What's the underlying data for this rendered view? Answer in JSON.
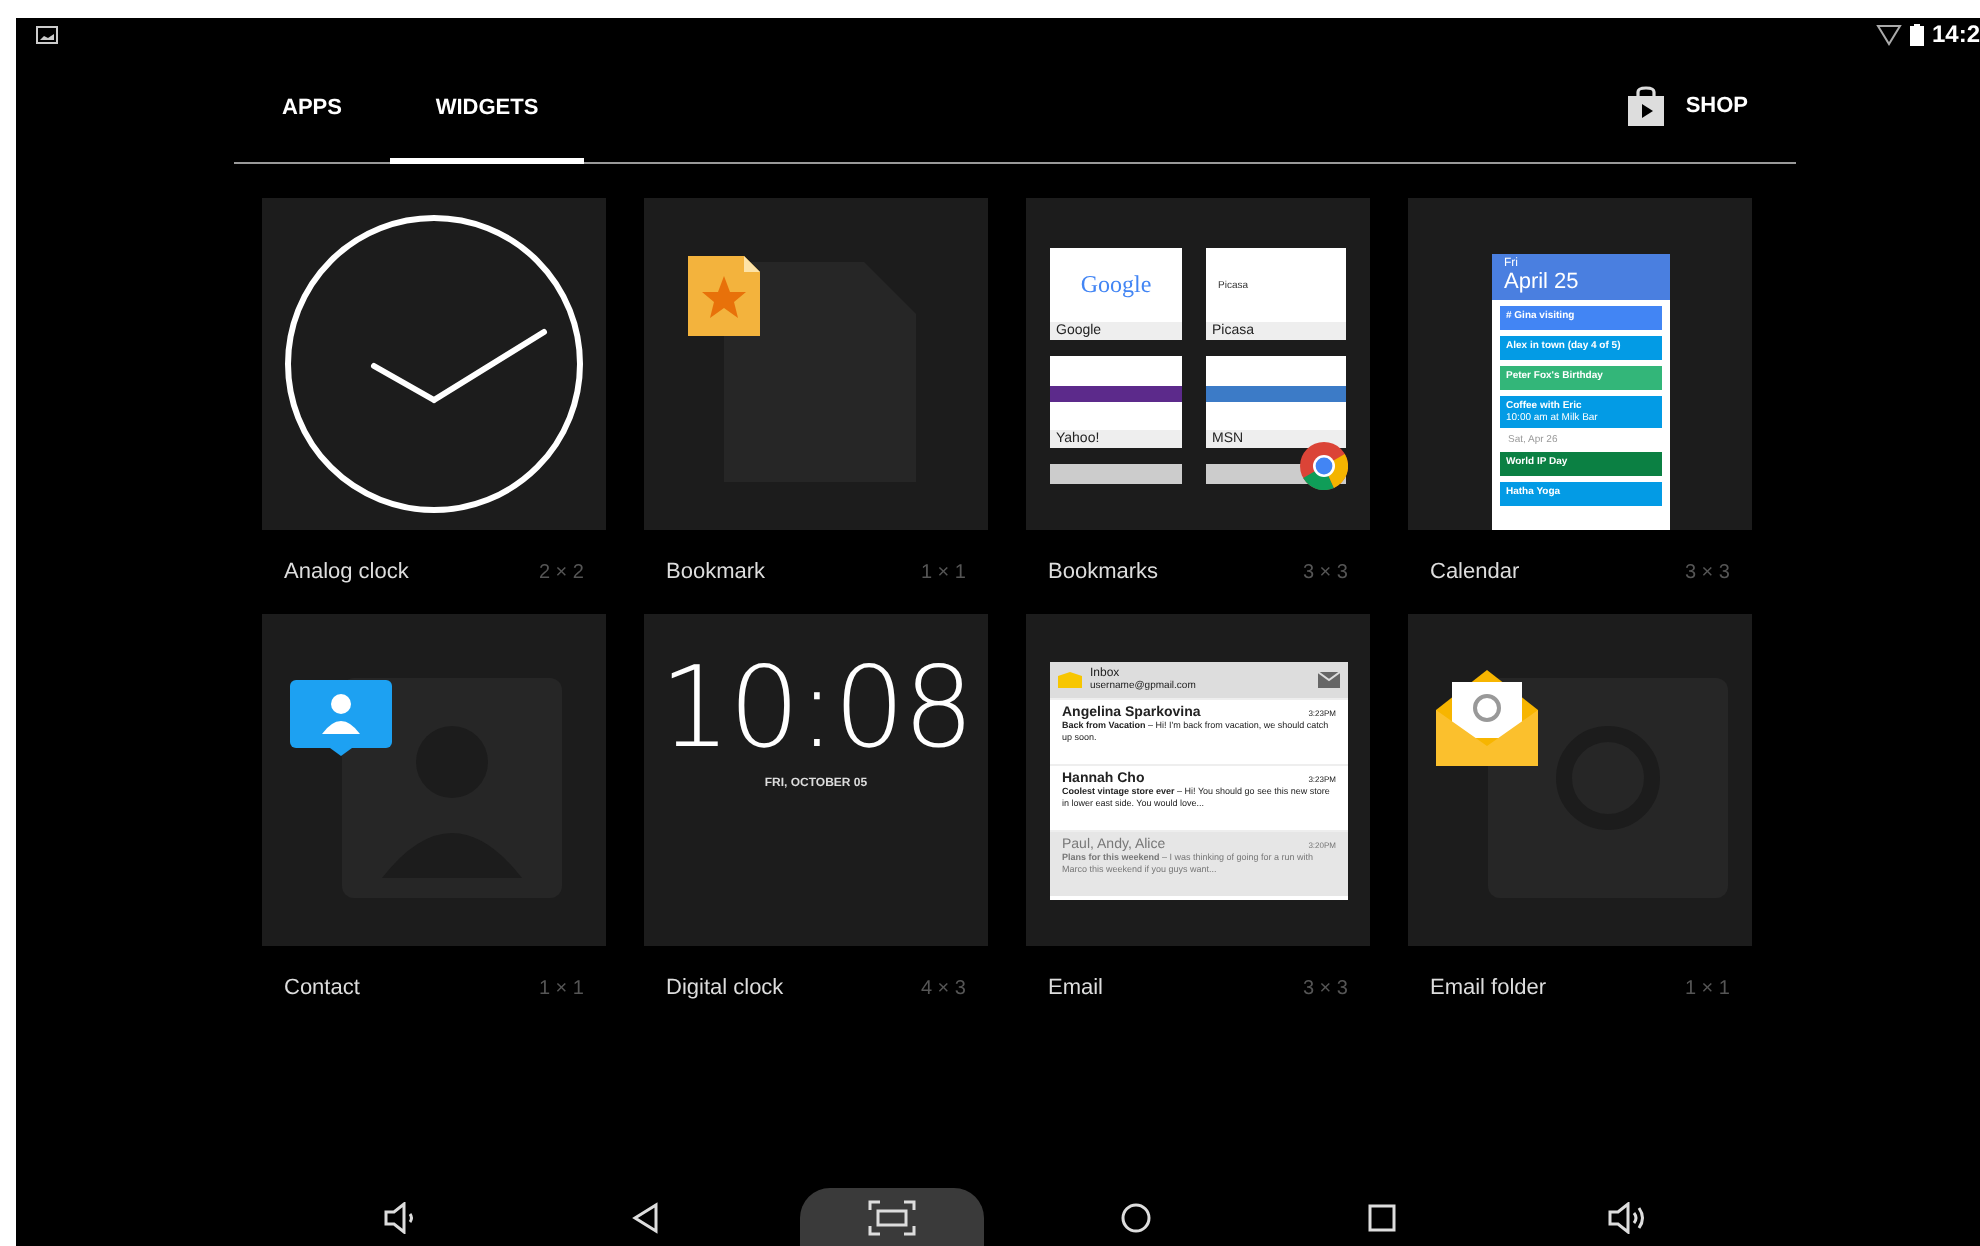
{
  "status_bar": {
    "time": "14:2"
  },
  "tabs": [
    {
      "label": "APPS",
      "selected": false
    },
    {
      "label": "WIDGETS",
      "selected": true
    }
  ],
  "shop": {
    "label": "SHOP"
  },
  "widgets": [
    {
      "name": "Analog clock",
      "size": "2 × 2",
      "kind": "analog_clock"
    },
    {
      "name": "Bookmark",
      "size": "1 × 1",
      "kind": "bookmark"
    },
    {
      "name": "Bookmarks",
      "size": "3 × 3",
      "kind": "bookmarks",
      "preview": {
        "logo": "Google",
        "sites": [
          "Google",
          "Picasa",
          "Yahoo!",
          "MSN"
        ],
        "header": "Picasa"
      }
    },
    {
      "name": "Calendar",
      "size": "3 × 3",
      "kind": "calendar",
      "preview": {
        "weekday": "Fri",
        "date": "April 25",
        "events": [
          {
            "title": "# Gina visiting",
            "color": "#4285f4"
          },
          {
            "title": "Alex in town (day 4 of 5)",
            "color": "#039be5"
          },
          {
            "title": "Peter Fox's Birthday",
            "color": "#33b679"
          },
          {
            "title": "Coffee with Eric",
            "detail": "10:00 am at Milk Bar",
            "color": "#039be5"
          }
        ],
        "next_day": "Sat, Apr 26",
        "next_events": [
          {
            "title": "World IP Day",
            "color": "#0b8043"
          },
          {
            "title": "Hatha Yoga",
            "color": "#039be5"
          }
        ]
      }
    },
    {
      "name": "Contact",
      "size": "1 × 1",
      "kind": "contact"
    },
    {
      "name": "Digital clock",
      "size": "4 × 3",
      "kind": "digital_clock",
      "preview": {
        "time": "10:08",
        "date": "FRI, OCTOBER 05"
      }
    },
    {
      "name": "Email",
      "size": "3 × 3",
      "kind": "email",
      "preview": {
        "folder": "Inbox",
        "account": "username@gpmail.com",
        "messages": [
          {
            "from": "Angelina Sparkovina",
            "time": "3:23PM",
            "subject": "Back from Vacation",
            "snippet": " – Hi! I'm back from vacation, we should catch up soon.",
            "read": false
          },
          {
            "from": "Hannah Cho",
            "time": "3:23PM",
            "subject": "Coolest vintage store ever",
            "snippet": " – Hi! You should go see this new store in lower east side. You would love...",
            "read": false
          },
          {
            "from": "Paul, Andy, Alice",
            "time": "3:20PM",
            "subject": "Plans for this weekend",
            "snippet": " – I was thinking of going for a run with Marco this weekend if you guys want...",
            "read": true
          }
        ]
      }
    },
    {
      "name": "Email folder",
      "size": "1 × 1",
      "kind": "email_folder"
    }
  ],
  "nav_bar": [
    {
      "kind": "volume_down",
      "selected": false
    },
    {
      "kind": "back",
      "selected": false
    },
    {
      "kind": "screenshot",
      "selected": true
    },
    {
      "kind": "home",
      "selected": false
    },
    {
      "kind": "recents",
      "selected": false
    },
    {
      "kind": "volume_up",
      "selected": false
    }
  ]
}
